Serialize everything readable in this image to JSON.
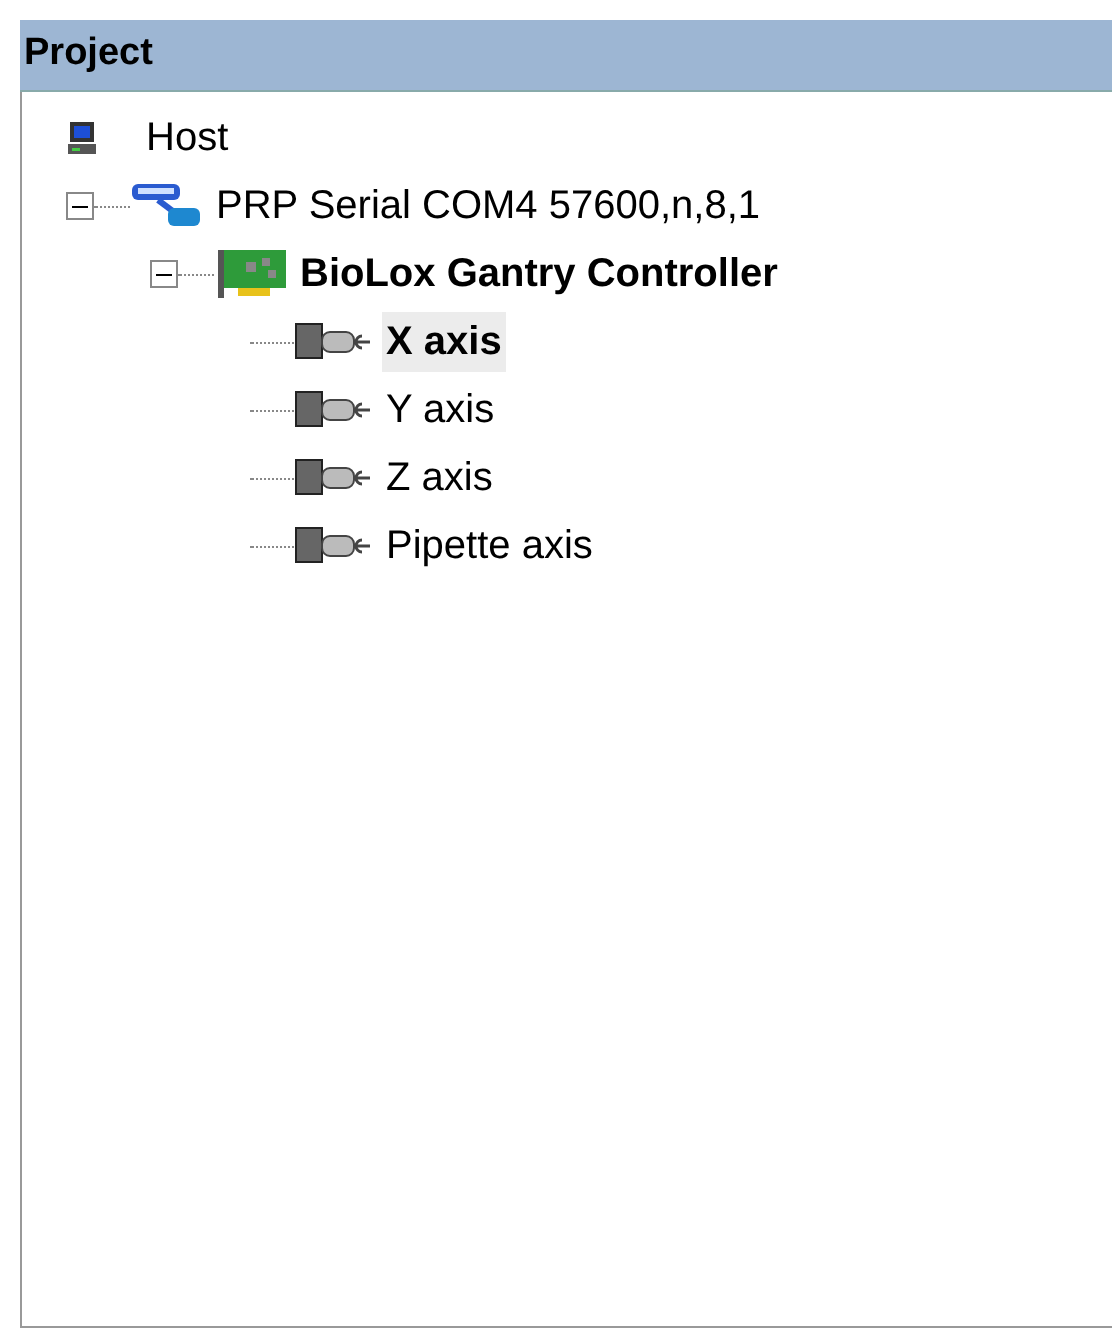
{
  "panel": {
    "title": "Project"
  },
  "tree": [
    {
      "label": "Host",
      "kind": "computer",
      "selected": false
    },
    {
      "label": "PRP Serial COM4 57600,n,8,1",
      "kind": "serial",
      "selected": false,
      "expanded": true,
      "children": [
        {
          "label": "BioLox Gantry Controller",
          "kind": "board",
          "bold": true,
          "selected": false,
          "expanded": true,
          "children": [
            {
              "label": "X axis",
              "kind": "motor",
              "selected": true
            },
            {
              "label": "Y axis",
              "kind": "motor",
              "selected": false
            },
            {
              "label": "Z axis",
              "kind": "motor",
              "selected": false
            },
            {
              "label": "Pipette axis",
              "kind": "motor",
              "selected": false
            }
          ]
        }
      ]
    }
  ]
}
